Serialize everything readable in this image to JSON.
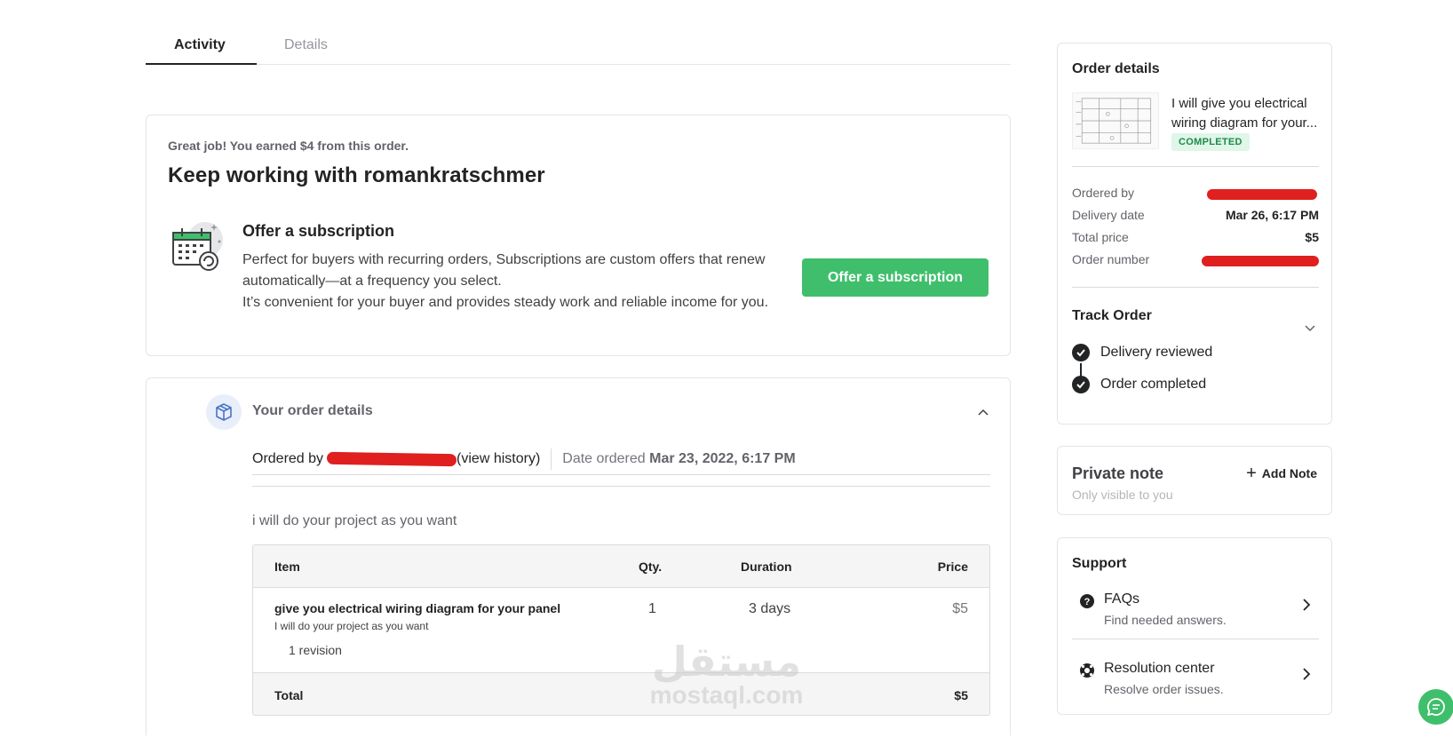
{
  "tabs": [
    {
      "label": "Activity",
      "active": true
    },
    {
      "label": "Details",
      "active": false
    }
  ],
  "subscription": {
    "earned_text": "Great job! You earned $4 from this order.",
    "headline": "Keep working with romankratschmer",
    "offer_title": "Offer a subscription",
    "offer_desc_1": "Perfect for buyers with recurring orders, Subscriptions are custom offers that renew automatically—at a frequency you select.",
    "offer_desc_2": "It’s convenient for your buyer and provides steady work and reliable income for you.",
    "button_label": "Offer a subscription",
    "icon": "calendar-refresh-icon"
  },
  "order": {
    "heading": "Your order details",
    "ordered_by_label": "Ordered by",
    "view_history": "(view history)",
    "date_label": "Date ordered",
    "date_value": "Mar 23, 2022, 6:17 PM",
    "project_text": "i will do your project as you want",
    "table": {
      "headers": {
        "item": "Item",
        "qty": "Qty.",
        "duration": "Duration",
        "price": "Price"
      },
      "row": {
        "name": "give you electrical wiring diagram for your panel",
        "sub": "I will do your project as you want",
        "revision": "1 revision",
        "qty": "1",
        "duration": "3 days",
        "price": "$5"
      },
      "total_label": "Total",
      "total_value": "$5"
    }
  },
  "watermark": {
    "ar": "مستقل",
    "en": "mostaql.com"
  },
  "sidebar": {
    "order_details": {
      "title": "Order details",
      "gig_title": "I will give you electrical wiring diagram for your...",
      "status": "COMPLETED",
      "ordered_by_label": "Ordered by",
      "delivery_date_label": "Delivery date",
      "delivery_date_value": "Mar 26, 6:17 PM",
      "total_price_label": "Total price",
      "total_price_value": "$5",
      "order_number_label": "Order number"
    },
    "track": {
      "title": "Track Order",
      "steps": [
        "Delivery reviewed",
        "Order completed"
      ]
    },
    "note": {
      "title": "Private note",
      "subtitle": "Only visible to you",
      "add_label": "Add Note"
    },
    "support": {
      "title": "Support",
      "items": [
        {
          "label": "FAQs",
          "desc": "Find needed answers.",
          "icon": "question-circle-icon"
        },
        {
          "label": "Resolution center",
          "desc": "Resolve order issues.",
          "icon": "lifebuoy-icon"
        }
      ]
    }
  },
  "colors": {
    "accent": "#3fbf6b",
    "redaction": "#e01f1f",
    "badge_bg": "#dff6e8",
    "badge_text": "#1d8a4a"
  }
}
